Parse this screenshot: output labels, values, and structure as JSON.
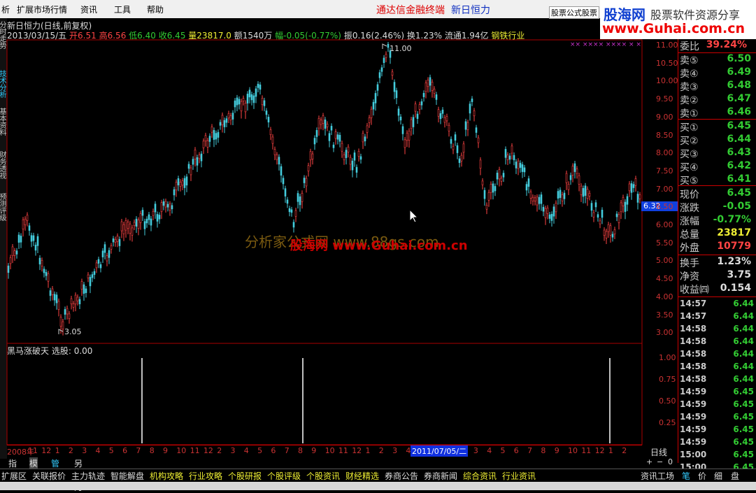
{
  "menu": {
    "items": [
      "析",
      "扩展市场行情",
      "资讯",
      "工具",
      "帮助"
    ],
    "title": "通达信金融终端",
    "stock": "新日恒力",
    "formula_btn": "股票公式股票"
  },
  "logo": {
    "line1": "股海网",
    "line1b": "股票软件资源分享",
    "line2": "www.Guhai.com.cn"
  },
  "left_tabs": [
    "分时走势",
    "技术分析",
    "基本资料",
    "财务透视",
    "预测评级"
  ],
  "chart_header": {
    "title": "新日恒力(日线,前复权)",
    "date": "2013/03/15/五",
    "open": "开6.51",
    "high": "高6.56",
    "low": "低6.40",
    "close": "收6.45",
    "volume": "量23817.0",
    "amount": "额1540万",
    "change": "幅-0.05(-0.77%)",
    "amplitude": "振0.16(2.46%)",
    "turnover": "换1.23%",
    "float": "流通1.94亿",
    "industry": "钢铁行业"
  },
  "price_marks": {
    "high": "11.00",
    "low": "3.05",
    "current": "6.32"
  },
  "price_axis": [
    "11.00",
    "10.50",
    "10.00",
    "9.50",
    "9.00",
    "8.50",
    "8.00",
    "7.50",
    "7.00",
    "6.50",
    "6.00",
    "5.50",
    "5.00",
    "4.50",
    "4.00",
    "3.50",
    "3.00"
  ],
  "indicator": {
    "name": "黑马涨破天",
    "pick": "选股: 0.00",
    "axis": [
      "1.00",
      "0.75",
      "0.50",
      "0.25"
    ]
  },
  "xaxis": {
    "labels": [
      "2008年",
      "11",
      "12",
      "1",
      "2",
      "3",
      "4",
      "5",
      "6",
      "7",
      "8",
      "9",
      "10",
      "11",
      "12",
      "2",
      "3",
      "4",
      "5",
      "6",
      "7",
      "8",
      "9",
      "10",
      "11",
      "12",
      "1",
      "2",
      "3",
      "4",
      "5",
      "6",
      "1",
      "2",
      "3",
      "4",
      "5",
      "6",
      "7",
      "8",
      "9",
      "10",
      "11",
      "12",
      "1",
      "2"
    ],
    "highlight": "2011/07/05/二",
    "period": "日线"
  },
  "watermark": {
    "a": "分析家公式网 www.88gs.com",
    "b": "股海网 www.Guhai.com.cn"
  },
  "quote": {
    "weibi_label": "委比",
    "weibi": "39.24%",
    "sell": [
      {
        "l": "卖⑤",
        "v": "6.50"
      },
      {
        "l": "卖④",
        "v": "6.49"
      },
      {
        "l": "卖③",
        "v": "6.48"
      },
      {
        "l": "卖②",
        "v": "6.47"
      },
      {
        "l": "卖①",
        "v": "6.46"
      }
    ],
    "buy": [
      {
        "l": "买①",
        "v": "6.45"
      },
      {
        "l": "买②",
        "v": "6.44"
      },
      {
        "l": "买③",
        "v": "6.43"
      },
      {
        "l": "买④",
        "v": "6.42"
      },
      {
        "l": "买⑤",
        "v": "6.41"
      }
    ],
    "stats": [
      {
        "l": "现价",
        "v": "6.45"
      },
      {
        "l": "涨跌",
        "v": "-0.05"
      },
      {
        "l": "涨幅",
        "v": "-0.77%"
      },
      {
        "l": "总量",
        "v": "23817"
      },
      {
        "l": "外盘",
        "v": "10779"
      }
    ],
    "stats2": [
      {
        "l": "换手",
        "v": "1.23%"
      },
      {
        "l": "净资",
        "v": "3.75"
      },
      {
        "l": "收益㈣",
        "v": "0.154"
      }
    ]
  },
  "ticks": [
    {
      "t": "14:57",
      "v": "6.44"
    },
    {
      "t": "14:57",
      "v": "6.44"
    },
    {
      "t": "14:58",
      "v": "6.44"
    },
    {
      "t": "14:58",
      "v": "6.44"
    },
    {
      "t": "14:58",
      "v": "6.44"
    },
    {
      "t": "14:58",
      "v": "6.44"
    },
    {
      "t": "14:58",
      "v": "6.44"
    },
    {
      "t": "14:59",
      "v": "6.45"
    },
    {
      "t": "14:59",
      "v": "6.45"
    },
    {
      "t": "14:59",
      "v": "6.45"
    },
    {
      "t": "14:59",
      "v": "6.45"
    },
    {
      "t": "14:59",
      "v": "6.45"
    },
    {
      "t": "15:00",
      "v": "6.45"
    },
    {
      "t": "15:00",
      "v": "6.45"
    }
  ],
  "bottom_tabs": [
    "指标",
    "模板",
    "管理",
    "另存为"
  ],
  "bottom_bar": [
    "扩展区",
    "关联报价",
    "主力轨迹",
    "智能解盘",
    "机构攻略",
    "行业攻略",
    "个股研报",
    "个股评级",
    "个股资讯",
    "财经精选",
    "券商公告",
    "券商新闻",
    "综合资讯",
    "行业资讯"
  ],
  "right_bottom": [
    "资讯工场",
    "笔",
    "价",
    "细",
    "盘"
  ],
  "zoom_ctrl": [
    "+",
    "−",
    "0"
  ]
}
